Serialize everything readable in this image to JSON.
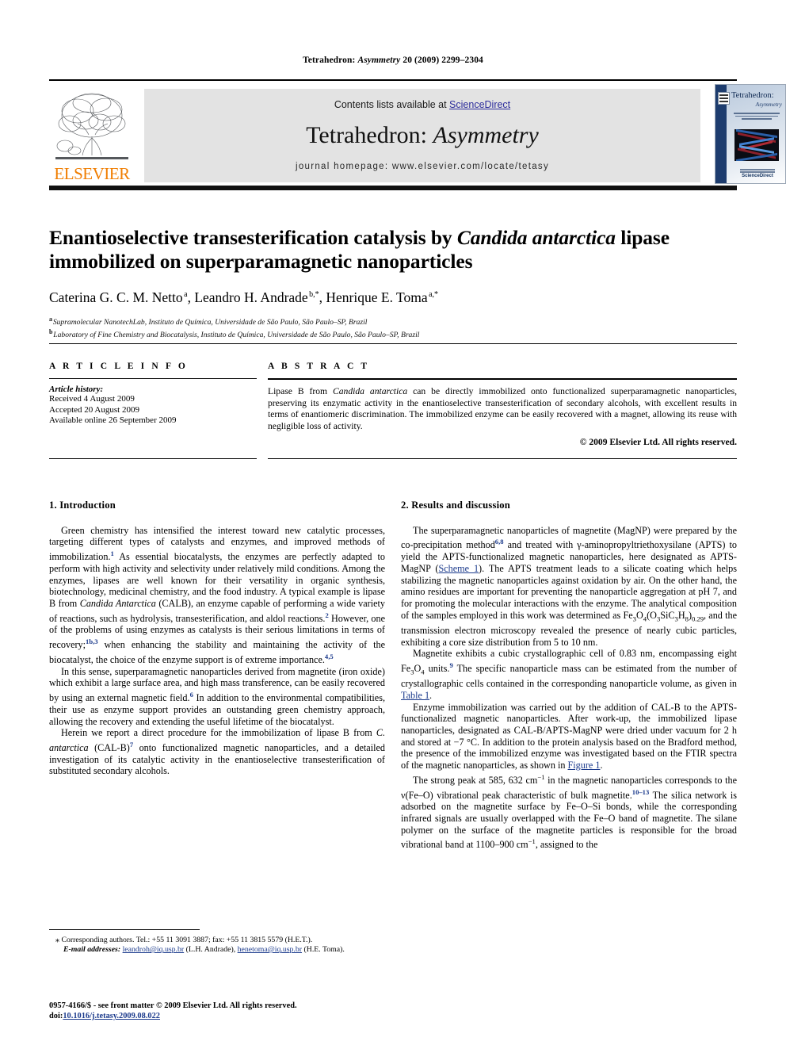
{
  "running_head": {
    "journal": "Tetrahedron:",
    "journal_italic": "Asymmetry",
    "citation": "20 (2009) 2299–2304"
  },
  "masthead": {
    "contents_prefix": "Contents lists available at ",
    "sciencedirect": "ScienceDirect",
    "journal_title_main": "Tetrahedron: ",
    "journal_title_italic": "Asymmetry",
    "homepage": "journal homepage: www.elsevier.com/locate/tetasy",
    "publisher_wordmark": "ELSEVIER",
    "accent_orange": "#F07D00",
    "link_blue": "#2c2c9c",
    "band_grey": "#e3e3e3"
  },
  "cover": {
    "title": "Tetrahedron:",
    "subtitle": "Asymmetry",
    "footer_brand": "ScienceDirect"
  },
  "title_block": {
    "title_part1": "Enantioselective transesterification catalysis by ",
    "title_italic": "Candida antarctica",
    "title_part2": " lipase immobilized on superparamagnetic nanoparticles",
    "authors_html": "Caterina G. C. M. Netto <sup>a</sup>, Leandro H. Andrade <sup>b,*</sup>, Henrique E. Toma <sup>a,*</sup>",
    "affiliation_a": "Supramolecular NanotechLab, Instituto de Química, Universidade de São Paulo, São Paulo–SP, Brazil",
    "affiliation_b": "Laboratory of Fine Chemistry and Biocatalysis, Instituto de Química, Universidade de São Paulo, São Paulo–SP, Brazil"
  },
  "article_info": {
    "heading": "A R T I C L E  I N F O",
    "history_heading": "Article history:",
    "received": "Received 4 August 2009",
    "accepted": "Accepted 20 August 2009",
    "available": "Available online 26 September 2009"
  },
  "abstract": {
    "heading": "A B S T R A C T",
    "text_part1": "Lipase B from ",
    "text_italic": "Candida antarctica",
    "text_part2": " can be directly immobilized onto functionalized superparamagnetic nanoparticles, preserving its enzymatic activity in the enantioselective transesterification of secondary alcohols, with excellent results in terms of enantiomeric discrimination. The immobilized enzyme can be easily recovered with a magnet, allowing its reuse with negligible loss of activity.",
    "copyright": "© 2009 Elsevier Ltd. All rights reserved."
  },
  "sections": {
    "introduction_heading": "1. Introduction",
    "results_heading": "2. Results and discussion"
  },
  "body": {
    "intro_p1_a": "Green chemistry has intensified the interest toward new catalytic processes, targeting different types of catalysts and enzymes, and improved methods of immobilization.",
    "intro_p1_ref1": "1",
    "intro_p1_b": " As essential biocatalysts, the enzymes are perfectly adapted to perform with high activity and selectivity under relatively mild conditions. Among the enzymes, lipases are well known for their versatility in organic synthesis, biotechnology, medicinal chemistry, and the food industry. A typical example is lipase B from ",
    "intro_p1_it1": "Candida Antarctica",
    "intro_p1_c": " (CALB), an enzyme capable of performing a wide variety of reactions, such as hydrolysis, transesterification, and aldol reactions.",
    "intro_p1_ref2": "2",
    "intro_p1_d": " However, one of the problems of using enzymes as catalysts is their serious limitations in terms of recovery;",
    "intro_p1_ref3": "1b,3",
    "intro_p1_e": " when enhancing the stability and maintaining the activity of the biocatalyst, the choice of the enzyme support is of extreme importance.",
    "intro_p1_ref4": "4,5",
    "intro_p2_a": "In this sense, superparamagnetic nanoparticles derived from magnetite (iron oxide) which exhibit a large surface area, and high mass transference, can be easily recovered by using an external magnetic field.",
    "intro_p2_ref1": "6",
    "intro_p2_b": " In addition to the environmental compatibilities, their use as enzyme support provides an outstanding green chemistry approach, allowing the recovery and extending the useful lifetime of the biocatalyst.",
    "intro_p3_a": "Herein we report a direct procedure for the immobilization of lipase B from ",
    "intro_p3_it1": "C. antarctica",
    "intro_p3_b": " (CAL-B)",
    "intro_p3_ref1": "7",
    "intro_p3_c": " onto functionalized magnetic nanoparticles, and a detailed investigation of its catalytic activity in the enantioselective transesterification of substituted secondary alcohols.",
    "res_p1_a": "The superparamagnetic nanoparticles of magnetite (MagNP) were prepared by the co-precipitation method",
    "res_p1_ref1": "6,8",
    "res_p1_b": " and treated with γ-aminopropyltriethoxysilane (APTS) to yield the APTS-functionalized magnetic nanoparticles, here designated as APTS-MagNP (",
    "res_p1_link1": "Scheme 1",
    "res_p1_c": "). The APTS treatment leads to a silicate coating which helps stabilizing the magnetic nanoparticles against oxidation by air. On the other hand, the amino residues are important for preventing the nanoparticle aggregation at pH 7, and for promoting the molecular interactions with the enzyme. The analytical composition of the samples employed in this work was determined as Fe",
    "res_p1_formula_sub1": "3",
    "res_p1_d": "O",
    "res_p1_formula_sub2": "4",
    "res_p1_e": "(O",
    "res_p1_formula_sub3": "3",
    "res_p1_f": "SiC",
    "res_p1_formula_sub4": "3",
    "res_p1_g": "H",
    "res_p1_formula_sub5": "8",
    "res_p1_h": ")",
    "res_p1_formula_sub6": "0.29",
    "res_p1_i": ", and the transmission electron microscopy revealed the presence of nearly cubic particles, exhibiting a core size distribution from 5 to 10 nm.",
    "res_p2_a": "Magnetite exhibits a cubic crystallographic cell of 0.83 nm, encompassing eight Fe",
    "res_p2_sub1": "3",
    "res_p2_b": "O",
    "res_p2_sub2": "4",
    "res_p2_c": " units.",
    "res_p2_ref1": "9",
    "res_p2_d": " The specific nanoparticle mass can be estimated from the number of crystallographic cells contained in the corresponding nanoparticle volume, as given in ",
    "res_p2_link1": "Table 1",
    "res_p2_e": ".",
    "res_p3_a": "Enzyme immobilization was carried out by the addition of CAL-B to the APTS-functionalized magnetic nanoparticles. After work-up, the immobilized lipase nanoparticles, designated as CAL-B/APTS-MagNP were dried under vacuum for 2 h and stored at −7 °C. In addition to the protein analysis based on the Bradford method, the presence of the immobilized enzyme was investigated based on the FTIR spectra of the magnetic nanoparticles, as shown in ",
    "res_p3_link1": "Figure 1",
    "res_p3_b": ".",
    "res_p4_a": "The strong peak at 585, 632 cm",
    "res_p4_sup1": "−1",
    "res_p4_b": " in the magnetic nanoparticles corresponds to the ν(Fe–O) vibrational peak characteristic of bulk magnetite.",
    "res_p4_ref1": "10–13",
    "res_p4_c": " The silica network is adsorbed on the magnetite surface by Fe–O–Si bonds, while the corresponding infrared signals are usually overlapped with the Fe–O band of magnetite. The silane polymer on the surface of the magnetite particles is responsible for the broad vibrational band at 1100–900 cm",
    "res_p4_sup2": "−1",
    "res_p4_d": ", assigned to the"
  },
  "footnotes": {
    "corresponding": "Corresponding authors. Tel.: +55 11 3091 3887; fax: +55 11 3815 5579 (H.E.T.).",
    "email_label": "E-mail addresses:",
    "email1": "leandroh@iq.usp.br",
    "email1_owner": " (L.H. Andrade), ",
    "email2": "henetoma@iq.usp.br",
    "email2_owner": " (H.E. Toma)."
  },
  "imprint": {
    "line1": "0957-4166/$ - see front matter © 2009 Elsevier Ltd. All rights reserved.",
    "doi_label": "doi:",
    "doi_value": "10.1016/j.tetasy.2009.08.022"
  }
}
